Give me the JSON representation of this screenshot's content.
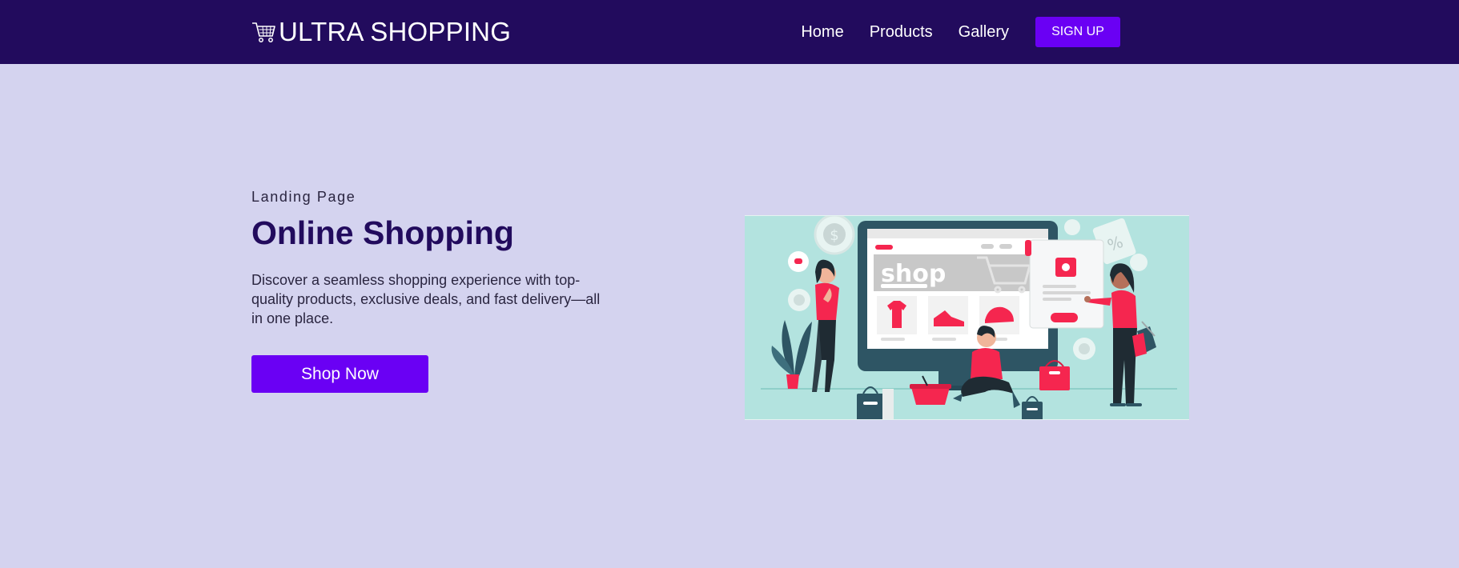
{
  "header": {
    "brand": "ULTRA SHOPPING",
    "brand_icon": "shopping-cart-icon",
    "nav": [
      "Home",
      "Products",
      "Gallery"
    ],
    "signup_label": "SIGN UP"
  },
  "hero": {
    "eyebrow": "Landing Page",
    "title": "Online Shopping",
    "description": "Discover a seamless shopping experience with top-quality products, exclusive deals, and fast delivery—all in one place.",
    "cta_label": "Shop Now",
    "illustration": {
      "screen_word": "shop",
      "tag_text": "%"
    }
  },
  "colors": {
    "nav_bg": "#220b5d",
    "page_bg": "#d4d3ef",
    "accent": "#6a00f4",
    "title": "#220b5d",
    "illustration_bg": "#b3e3df",
    "illustration_accent": "#f5264f"
  }
}
